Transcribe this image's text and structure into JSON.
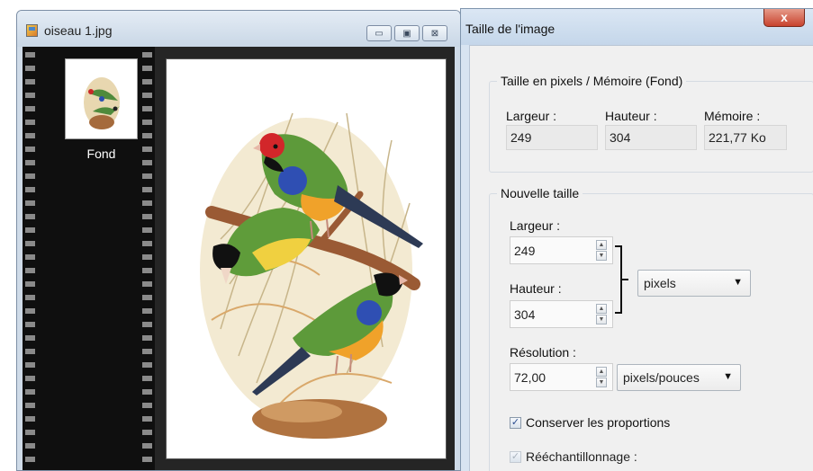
{
  "image_window": {
    "title": "oiseau 1.jpg",
    "buttons": {
      "minimize": "▭",
      "maximize": "▣",
      "close": "⊠"
    },
    "layer_label": "Fond"
  },
  "dialog": {
    "title": "Taille de l'image",
    "close_glyph": "x",
    "current": {
      "legend": "Taille en pixels / Mémoire (Fond)",
      "width_label": "Largeur :",
      "height_label": "Hauteur :",
      "memory_label": "Mémoire :",
      "width_value": "249",
      "height_value": "304",
      "memory_value": "221,77 Ko"
    },
    "new_size": {
      "legend": "Nouvelle taille",
      "width_label": "Largeur :",
      "width_value": "249",
      "height_label": "Hauteur :",
      "height_value": "304",
      "unit": "pixels",
      "resolution_label": "Résolution :",
      "resolution_value": "72,00",
      "resolution_unit": "pixels/pouces",
      "keep_proportions_label": "Conserver les proportions",
      "resample_label": "Rééchantillonnage :"
    }
  }
}
